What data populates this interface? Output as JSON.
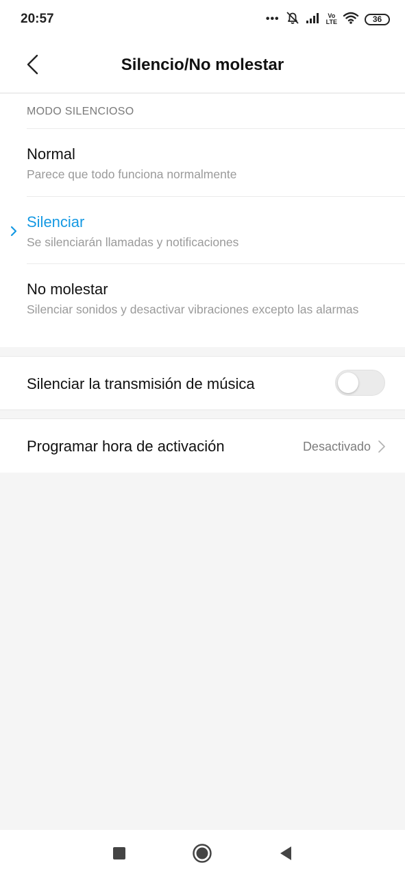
{
  "status_bar": {
    "time": "20:57",
    "dots": "•••",
    "network_label_top": "Vo",
    "network_label_bottom": "LTE",
    "battery": "36",
    "icons": [
      "more-dots-icon",
      "notifications-off-icon",
      "signal-icon",
      "volte-lte-icon",
      "wifi-icon",
      "battery-icon"
    ]
  },
  "header": {
    "title": "Silencio/No molestar",
    "back_icon": "chevron-left-icon"
  },
  "silent_mode": {
    "section_label": "MODO SILENCIOSO",
    "options": [
      {
        "title": "Normal",
        "subtitle": "Parece que todo funciona normalmente",
        "selected": false
      },
      {
        "title": "Silenciar",
        "subtitle": "Se silenciarán llamadas y notificaciones",
        "selected": true
      },
      {
        "title": "No molestar",
        "subtitle": "Silenciar sonidos y desactivar vibraciones excepto las alarmas",
        "selected": false
      }
    ]
  },
  "music_row": {
    "label": "Silenciar la transmisión de música",
    "toggle_on": false
  },
  "schedule_row": {
    "label": "Programar hora de activación",
    "value": "Desactivado"
  },
  "nav_bar": {
    "icons": [
      "recents-square-icon",
      "home-circle-icon",
      "back-triangle-icon"
    ]
  },
  "colors": {
    "accent": "#1599e3",
    "background": "#f5f5f5",
    "card": "#ffffff",
    "secondary_text": "#9a9a9a"
  }
}
